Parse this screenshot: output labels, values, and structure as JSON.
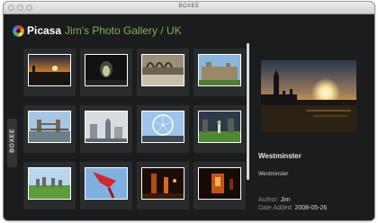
{
  "window": {
    "title": "BOXEE"
  },
  "header": {
    "brand": "Picasa",
    "gallery_title": "Jim's Photo Gallery / UK",
    "logo_icon": "picasa-logo-icon"
  },
  "sidebar": {
    "tab_label": "BOXEE"
  },
  "photos": [
    {
      "name": "sunset-river-thumbnail"
    },
    {
      "name": "dark-tunnel-thumbnail"
    },
    {
      "name": "cloister-arches-thumbnail"
    },
    {
      "name": "palace-building-thumbnail"
    },
    {
      "name": "tower-bridge-thumbnail"
    },
    {
      "name": "city-skyline-thumbnail"
    },
    {
      "name": "london-eye-thumbnail"
    },
    {
      "name": "stonehenge-person-thumbnail"
    },
    {
      "name": "stonehenge-field-thumbnail"
    },
    {
      "name": "red-flag-thumbnail"
    },
    {
      "name": "night-lights-thumbnail"
    },
    {
      "name": "orange-lights-thumbnail"
    }
  ],
  "preview": {
    "title": "Westminster",
    "subtitle": "Westminster",
    "author_label": "Author:",
    "author": "Jim",
    "date_label": "Date Added:",
    "date": "2008-05-26"
  }
}
